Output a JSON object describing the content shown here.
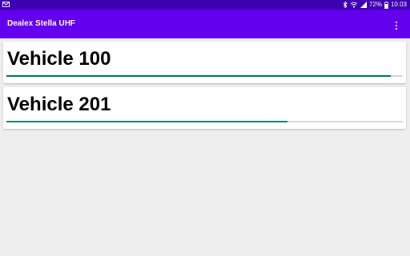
{
  "status_bar": {
    "battery_percent": "72%",
    "time": "10.03",
    "icons": [
      "gmail-icon",
      "bluetooth-icon",
      "wifi-icon",
      "signal-icon",
      "battery-icon"
    ]
  },
  "app_bar": {
    "title": "Dealex Stella UHF",
    "menu_icon": "overflow-menu-icon"
  },
  "vehicles": [
    {
      "name": "Vehicle 100",
      "progress": 0.97
    },
    {
      "name": "Vehicle 201",
      "progress": 0.71
    }
  ],
  "colors": {
    "status_bar": "#3d00b3",
    "app_bar": "#6200ee",
    "progress_fill": "#00796b",
    "progress_track": "#d6d6d6",
    "background": "#eeeeee"
  }
}
